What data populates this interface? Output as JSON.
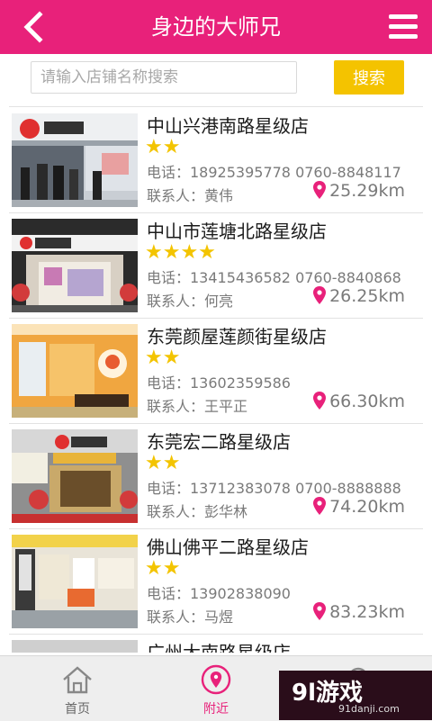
{
  "header": {
    "title": "身边的大师兄",
    "back_icon": "chevron-left-icon",
    "menu_icon": "hamburger-menu-icon",
    "color": "#e8217a"
  },
  "search": {
    "placeholder": "请输入店铺名称搜索",
    "button_label": "搜索",
    "button_color": "#f4c300"
  },
  "stores": [
    {
      "name": "中山兴港南路星级店",
      "stars": "★★",
      "rating": 2,
      "phone": "电话：18925395778  0760-8848117",
      "contact": "联系人：黄伟",
      "distance": "25.29km"
    },
    {
      "name": "中山市莲塘北路星级店",
      "stars": "★★★★",
      "rating": 4,
      "phone": "电话：13415436582  0760-8840868",
      "contact": "联系人：何亮",
      "distance": "26.25km"
    },
    {
      "name": "东莞颜屋莲颜街星级店",
      "stars": "★★",
      "rating": 2,
      "phone": "电话：13602359586",
      "contact": "联系人：王平正",
      "distance": "66.30km"
    },
    {
      "name": "东莞宏二路星级店",
      "stars": "★★",
      "rating": 2,
      "phone": "电话：13712383078  0700-8888888",
      "contact": "联系人：彭华林",
      "distance": "74.20km"
    },
    {
      "name": "佛山佛平二路星级店",
      "stars": "★★",
      "rating": 2,
      "phone": "电话：13902838090",
      "contact": "联系人：马煜",
      "distance": "83.23km"
    },
    {
      "name": "广州大南路星级店",
      "stars": "",
      "rating": 0,
      "phone": "",
      "contact": "",
      "distance": ""
    }
  ],
  "tabs": {
    "home": "首页",
    "nearby": "附近",
    "active": "nearby",
    "active_color": "#e8217a"
  },
  "watermark": {
    "logo": "9l游戏",
    "url": "91danji.com"
  }
}
